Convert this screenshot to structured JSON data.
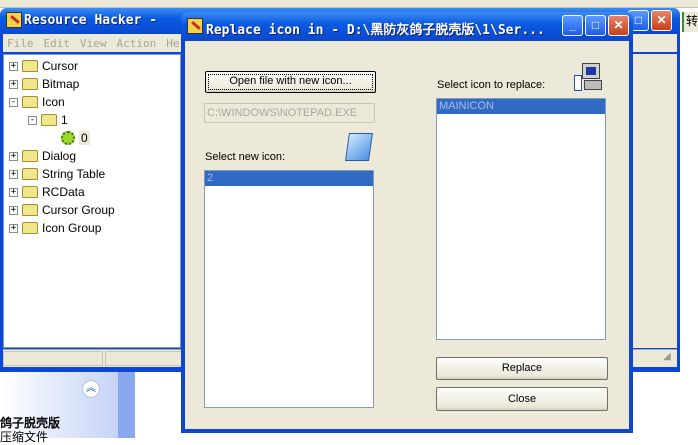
{
  "main_window": {
    "title": "Resource Hacker  -",
    "menu": [
      "File",
      "Edit",
      "View",
      "Action",
      "Help"
    ],
    "tree": [
      {
        "label": "Cursor",
        "expander": "+"
      },
      {
        "label": "Bitmap",
        "expander": "+"
      },
      {
        "label": "Icon",
        "expander": "-"
      },
      {
        "label": "1",
        "expander": "-"
      },
      {
        "label": "0",
        "expander": ""
      },
      {
        "label": "Dialog",
        "expander": "+"
      },
      {
        "label": "String Table",
        "expander": "+"
      },
      {
        "label": "RCData",
        "expander": "+"
      },
      {
        "label": "Cursor Group",
        "expander": "+"
      },
      {
        "label": "Icon Group",
        "expander": "+"
      }
    ]
  },
  "dialog": {
    "title": "Replace icon in - D:\\黑防灰鸽子脱壳版\\1\\Ser...",
    "open_button": "Open file with new icon...",
    "path_value": "C:\\WINDOWS\\NOTEPAD.EXE",
    "new_icon_label": "Select new icon:",
    "new_icon_items": [
      "2"
    ],
    "replace_label": "Select icon to replace:",
    "replace_items": [
      "MAINICON"
    ],
    "replace_button": "Replace",
    "close_button": "Close"
  },
  "background": {
    "right_text": "转",
    "task_heading": "鸽子脱壳版",
    "task_sub": "压缩文件"
  },
  "colors": {
    "titlebar": "#0a5ae0",
    "face": "#ece9d8",
    "selection": "#316ac5"
  }
}
